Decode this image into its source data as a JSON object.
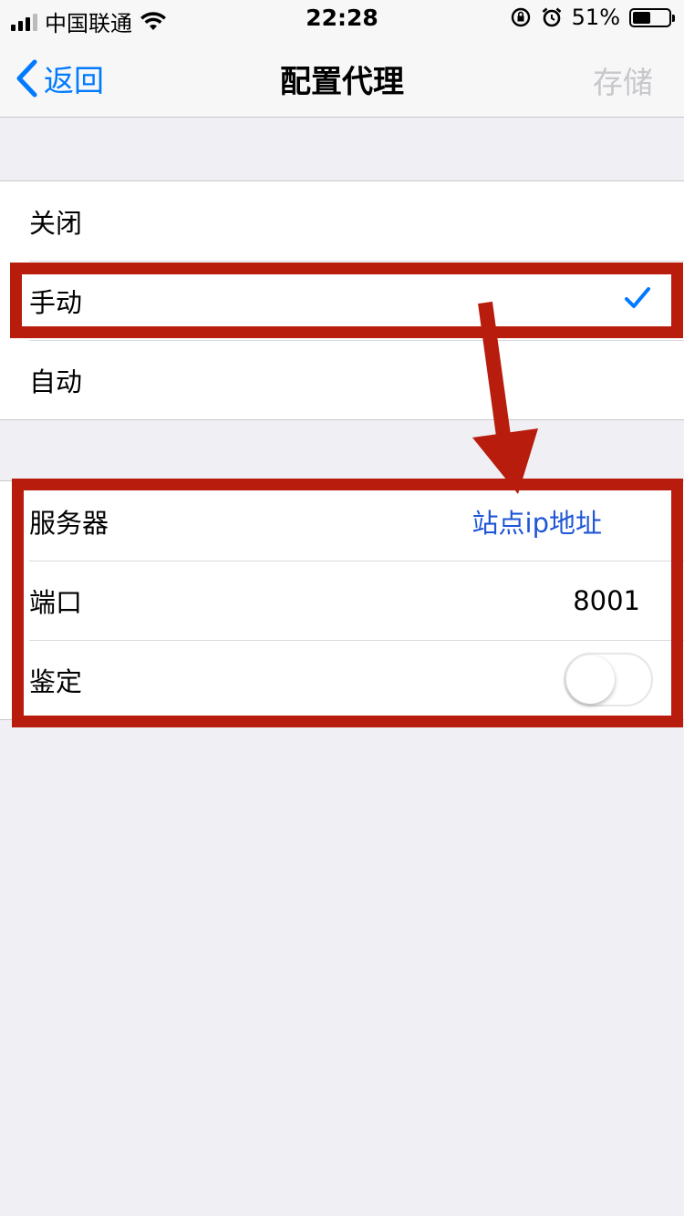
{
  "status_bar": {
    "carrier": "中国联通",
    "time": "22:28",
    "battery_percent": "51%",
    "battery_level": 0.51,
    "icons": [
      "signal-icon",
      "wifi-icon",
      "rotation-lock-icon",
      "alarm-icon",
      "battery-icon"
    ]
  },
  "nav": {
    "back_label": "返回",
    "title": "配置代理",
    "save_label": "存储"
  },
  "mode_options": [
    {
      "label": "关闭",
      "selected": false
    },
    {
      "label": "手动",
      "selected": true
    },
    {
      "label": "自动",
      "selected": false
    }
  ],
  "manual_settings": {
    "server_label": "服务器",
    "server_value": "站点ip地址",
    "port_label": "端口",
    "port_value": "8001",
    "auth_label": "鉴定",
    "auth_enabled": false
  },
  "colors": {
    "accent": "#007aff",
    "annotation": "#b81c0d",
    "disabled": "#c7c7cc",
    "link_text": "#1f56d6"
  }
}
